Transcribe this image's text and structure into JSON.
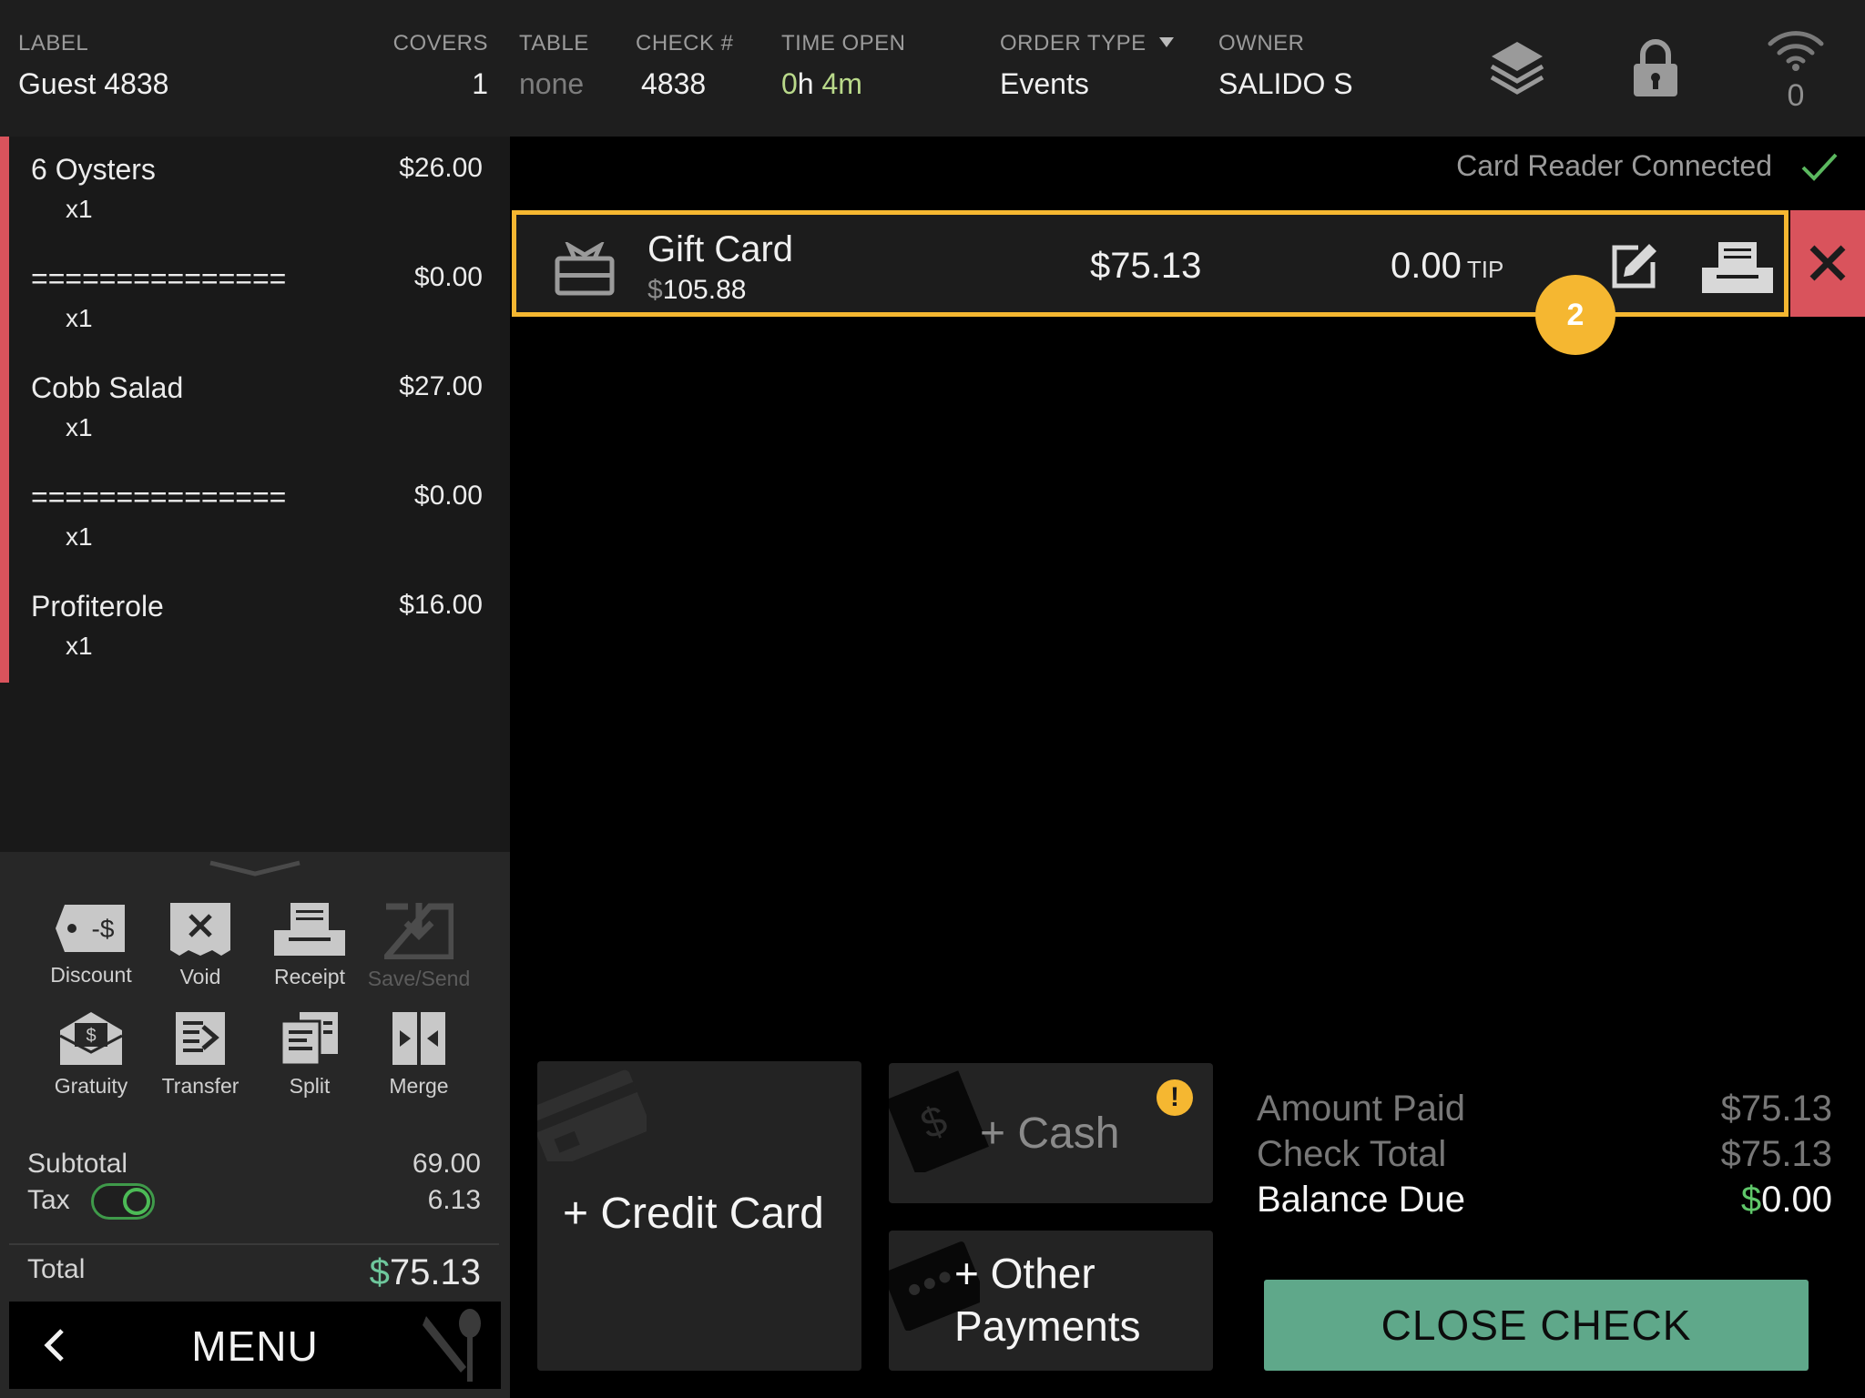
{
  "header": {
    "label": {
      "title": "LABEL",
      "value": "Guest 4838"
    },
    "covers": {
      "title": "COVERS",
      "value": "1"
    },
    "table": {
      "title": "TABLE",
      "value": "none"
    },
    "check": {
      "title": "CHECK #",
      "value": "4838"
    },
    "time_open": {
      "title": "TIME OPEN",
      "hours": "0",
      "h_unit": "h",
      "minutes": "4",
      "m_unit": "m"
    },
    "order_type": {
      "title": "ORDER TYPE",
      "value": "Events"
    },
    "owner": {
      "title": "OWNER",
      "value": "SALIDO S"
    },
    "icons": [
      "layers-icon",
      "lock-icon",
      "wifi-icon"
    ],
    "wifi_count": "0"
  },
  "order": {
    "items": [
      {
        "name": "6 Oysters",
        "price": "$26.00",
        "qty": "x1"
      },
      {
        "name": "===============",
        "price": "$0.00",
        "qty": "x1"
      },
      {
        "name": "Cobb Salad",
        "price": "$27.00",
        "qty": "x1"
      },
      {
        "name": "===============",
        "price": "$0.00",
        "qty": "x1"
      },
      {
        "name": "Profiterole",
        "price": "$16.00",
        "qty": "x1"
      }
    ],
    "accent_color": "#d9535c"
  },
  "actions": {
    "discount": "Discount",
    "void": "Void",
    "receipt": "Receipt",
    "save_send": "Save/Send",
    "gratuity": "Gratuity",
    "transfer": "Transfer",
    "split": "Split",
    "merge": "Merge"
  },
  "totals_left": {
    "subtotal_label": "Subtotal",
    "subtotal": "69.00",
    "tax_label": "Tax",
    "tax": "6.13",
    "tax_enabled": true,
    "total_label": "Total",
    "total_currency": "$",
    "total": "75.13"
  },
  "menu": {
    "label": "MENU"
  },
  "reader": {
    "status": "Card Reader Connected"
  },
  "payment": {
    "method": "Gift Card",
    "balance_currency": "$",
    "balance": "105.88",
    "amount": "$75.13",
    "tip": "0.00",
    "tip_label": "TIP",
    "step": "2",
    "highlight_color": "#f5b731"
  },
  "buttons": {
    "credit_card": "+ Credit Card",
    "cash": "+ Cash",
    "cash_warning": "!",
    "other_payments": "+ Other Payments"
  },
  "summary": {
    "amount_paid_label": "Amount Paid",
    "amount_paid": "$75.13",
    "check_total_label": "Check Total",
    "check_total": "$75.13",
    "balance_due_label": "Balance Due",
    "balance_currency": "$",
    "balance_due": "0.00"
  },
  "close_check": "CLOSE CHECK"
}
